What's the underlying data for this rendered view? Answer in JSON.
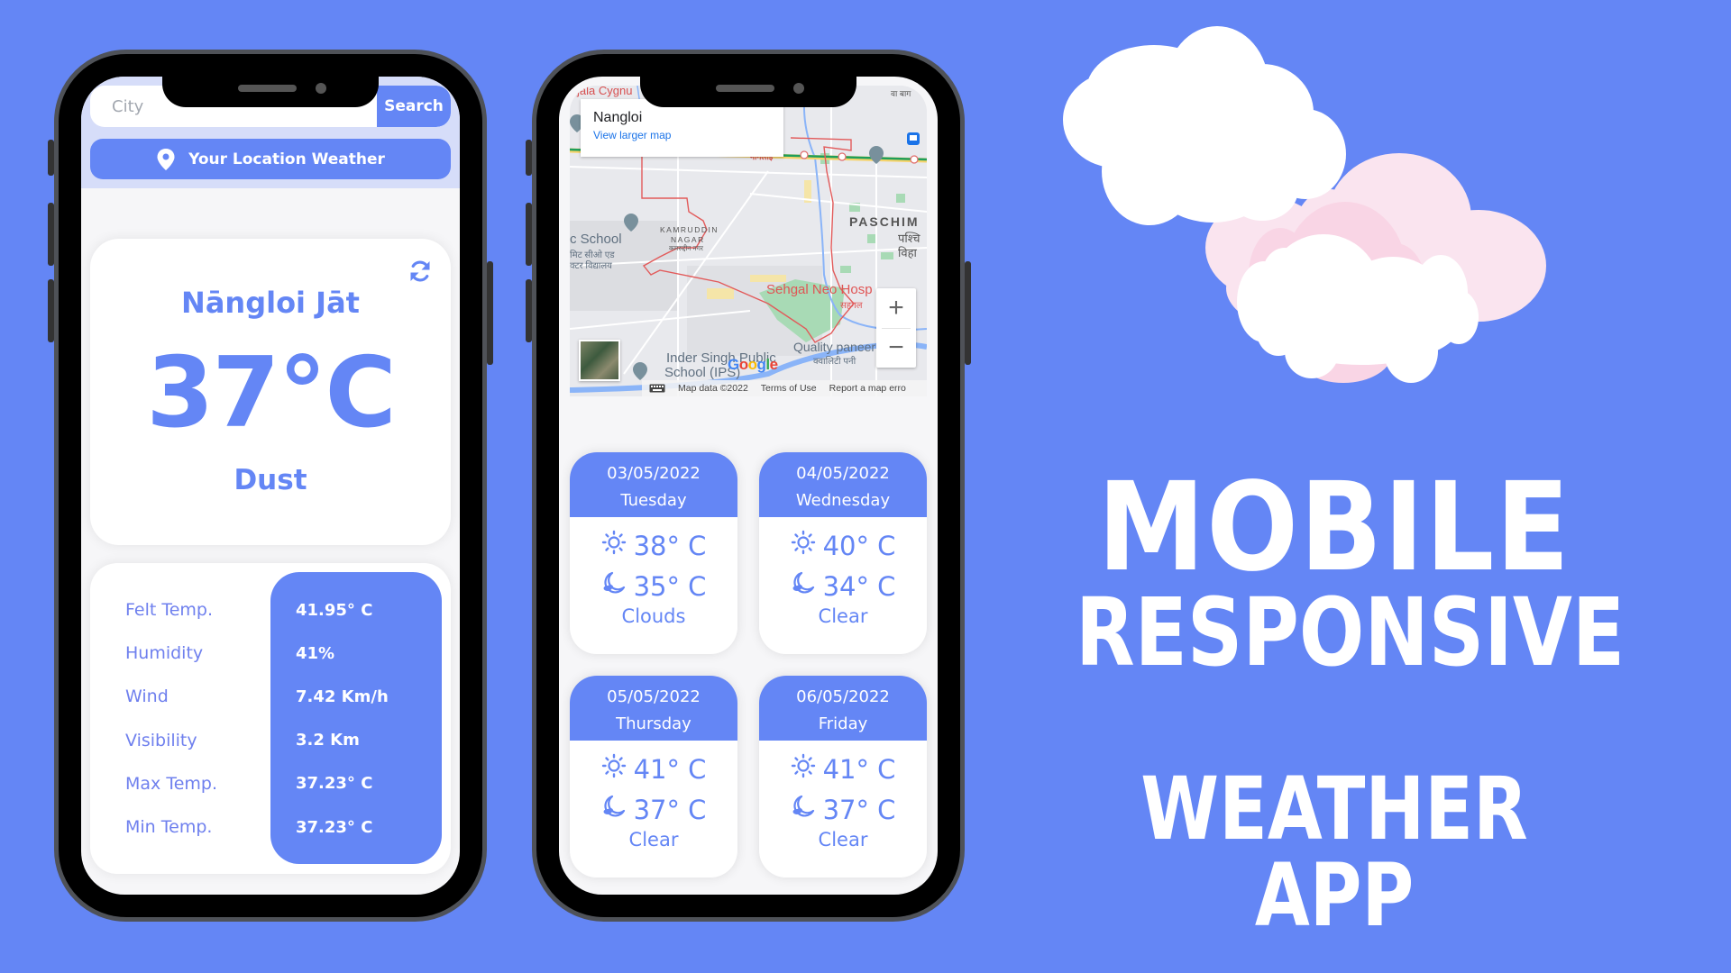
{
  "phone1": {
    "search": {
      "placeholder": "City",
      "value": "",
      "button_label": "Search"
    },
    "location_button_label": "Your Location Weather",
    "current": {
      "city": "Nāngloi Jāt",
      "temperature": "37°C",
      "condition": "Dust"
    },
    "details": [
      {
        "label": "Felt Temp.",
        "value": "41.95° C"
      },
      {
        "label": "Humidity",
        "value": "41%"
      },
      {
        "label": "Wind",
        "value": "7.42 Km/h"
      },
      {
        "label": "Visibility",
        "value": "3.2 Km"
      },
      {
        "label": "Max Temp.",
        "value": "37.23° C"
      },
      {
        "label": "Min Temp.",
        "value": "37.23° C"
      }
    ]
  },
  "phone2": {
    "map": {
      "place_name": "Nangloi",
      "view_larger_label": "View larger map",
      "labels": {
        "top_left": "jala Cygnu",
        "kamruddin": "KAMRUDDIN",
        "nagar": "NAGAR",
        "kamruddin_hi": "कमरुद्दीन नगर",
        "school_left": "c School",
        "school_left_hi": "मिट सीओ एड",
        "school_left_hi2": "क्टर विद्यालय",
        "paschim": "PASCHIM",
        "paschim_hi": "पश्चि",
        "paschim_hi2": "विहा",
        "nangloi_hi": "नांगलोई",
        "hospital": "Sehgal Neo Hosp",
        "hospital_hi": "सहगल",
        "quality": "Quality paneer",
        "quality_hi": "क्वालिटी पनी",
        "inder_school": "Inder Singh Public",
        "inder_school2": "School (IPS)",
        "top_right_hi": "वा बाग"
      },
      "zoom_in_label": "+",
      "zoom_out_label": "−",
      "google_logo": [
        "G",
        "o",
        "o",
        "g",
        "l",
        "e"
      ],
      "footer": {
        "map_data": "Map data ©2022",
        "terms": "Terms of Use",
        "report": "Report a map erro"
      }
    },
    "forecast": [
      {
        "date": "03/05/2022",
        "day": "Tuesday",
        "day_temp": "38° C",
        "night_temp": "35° C",
        "condition": "Clouds"
      },
      {
        "date": "04/05/2022",
        "day": "Wednesday",
        "day_temp": "40° C",
        "night_temp": "34° C",
        "condition": "Clear"
      },
      {
        "date": "05/05/2022",
        "day": "Thursday",
        "day_temp": "41° C",
        "night_temp": "37° C",
        "condition": "Clear"
      },
      {
        "date": "06/05/2022",
        "day": "Friday",
        "day_temp": "41° C",
        "night_temp": "37° C",
        "condition": "Clear"
      }
    ]
  },
  "headline": {
    "line1": "MOBILE",
    "line2": "RESPONSIVE",
    "line3": "WEATHER APP"
  },
  "colors": {
    "background": "#6486f5",
    "accent": "#6486f5",
    "top_bar": "#d6ddf9",
    "cloud_white": "#ffffff",
    "cloud_pink_light": "#fae4ef",
    "cloud_pink": "#f9d5e5"
  }
}
